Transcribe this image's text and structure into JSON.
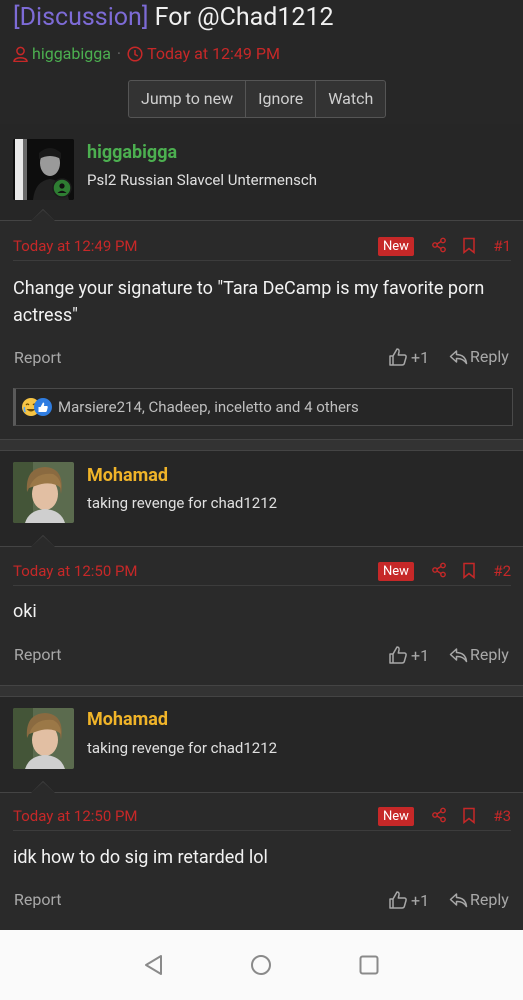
{
  "thread": {
    "prefix": "[Discussion]",
    "title": "For @Chad1212",
    "starter": "higgabigga",
    "separator": "·",
    "started_time": "Today at 12:49 PM"
  },
  "thread_buttons": [
    "Jump to new",
    "Ignore",
    "Watch"
  ],
  "posts": [
    {
      "author": "higgabigga",
      "author_color": "#4caf50",
      "user_title": "Psl2 Russian Slavcel Untermensch",
      "time": "Today at 12:49 PM",
      "new_label": "New",
      "number": "#1",
      "body": "Change your signature to \"Tara DeCamp is my favorite porn actress\"",
      "report": "Report",
      "like": "+1",
      "reply": "Reply",
      "reactions": "Marsiere214, Chadeep, inceletto and 4 others"
    },
    {
      "author": "Mohamad",
      "author_color": "#f0b429",
      "user_title": "taking revenge for chad1212",
      "time": "Today at 12:50 PM",
      "new_label": "New",
      "number": "#2",
      "body": "oki",
      "report": "Report",
      "like": "+1",
      "reply": "Reply"
    },
    {
      "author": "Mohamad",
      "author_color": "#f0b429",
      "user_title": "taking revenge for chad1212",
      "time": "Today at 12:50 PM",
      "new_label": "New",
      "number": "#3",
      "body": "idk how to do sig im retarded lol",
      "report": "Report",
      "like": "+1",
      "reply": "Reply"
    }
  ],
  "icons": {
    "user": "user-icon",
    "clock": "clock-icon",
    "share": "share-icon",
    "bookmark": "bookmark-icon",
    "thumbs_up": "thumbs-up-icon",
    "reply": "reply-icon",
    "nav_back": "back-triangle-icon",
    "nav_home": "home-circle-icon",
    "nav_recents": "recents-square-icon"
  },
  "colors": {
    "accent_red": "#c62828",
    "prefix_purple": "#7d6bd6",
    "background": "#2a2a2a"
  }
}
